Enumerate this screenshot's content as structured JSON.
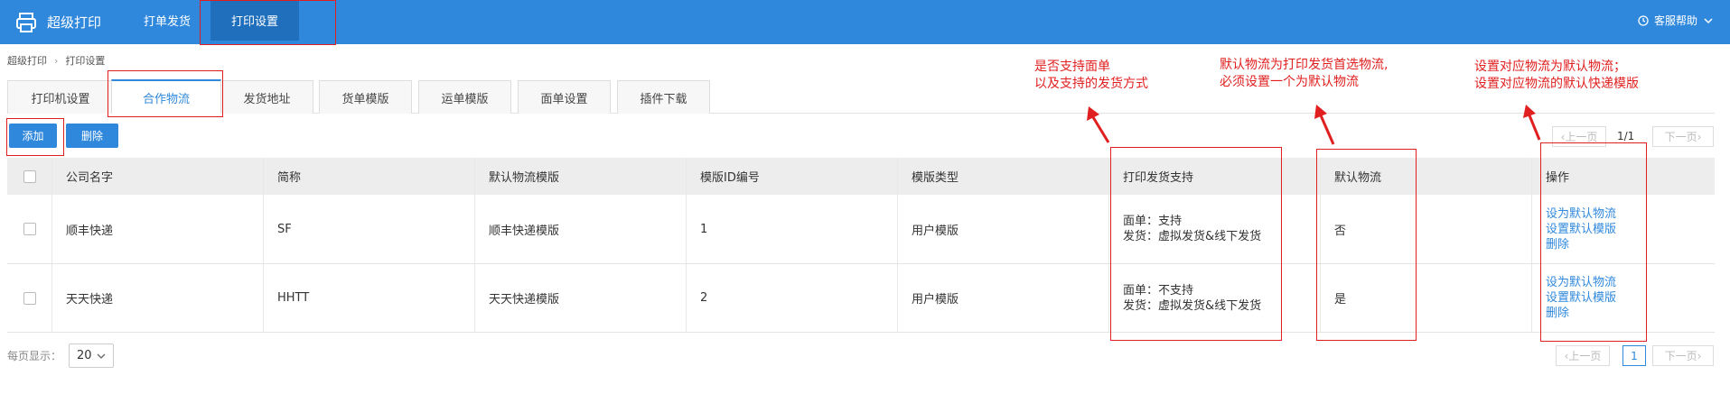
{
  "app": {
    "title": "超级打印"
  },
  "nav": [
    {
      "label": "打单发货"
    },
    {
      "label": "打印设置"
    }
  ],
  "help": {
    "label": "客服帮助"
  },
  "breadcrumb": {
    "root": "超级打印",
    "current": "打印设置"
  },
  "tabs": [
    {
      "label": "打印机设置"
    },
    {
      "label": "合作物流"
    },
    {
      "label": "发货地址"
    },
    {
      "label": "货单模版"
    },
    {
      "label": "运单模版"
    },
    {
      "label": "面单设置"
    },
    {
      "label": "插件下载"
    }
  ],
  "toolbar": {
    "add_label": "添加",
    "delete_label": "删除"
  },
  "pager_top": {
    "prev": "上一页",
    "page_info": "1/1",
    "next": "下一页"
  },
  "pager_bottom": {
    "prev": "上一页",
    "current": "1",
    "next": "下一页"
  },
  "table": {
    "headers": [
      "公司名字",
      "简称",
      "默认物流模版",
      "模版ID编号",
      "模版类型",
      "打印发货支持",
      "默认物流",
      "操作"
    ],
    "rows": [
      {
        "company": "顺丰快递",
        "short": "SF",
        "template": "顺丰快递模版",
        "template_id": "1",
        "template_type": "用户模版",
        "support_line1": "面单：支持",
        "support_line2": "发货：虚拟发货&线下发货",
        "is_default": "否",
        "actions": [
          "设为默认物流",
          "设置默认模版",
          "删除"
        ]
      },
      {
        "company": "天天快递",
        "short": "HHTT",
        "template": "天天快递模版",
        "template_id": "2",
        "template_type": "用户模版",
        "support_line1": "面单：不支持",
        "support_line2": "发货：虚拟发货&线下发货",
        "is_default": "是",
        "actions": [
          "设为默认物流",
          "设置默认模版",
          "删除"
        ]
      }
    ]
  },
  "per_page": {
    "label": "每页显示：",
    "value": "20"
  },
  "annotations": {
    "a1_line1": "是否支持面单",
    "a1_line2": "以及支持的发货方式",
    "a2_line1": "默认物流为打印发货首选物流,",
    "a2_line2": "必须设置一个为默认物流",
    "a3_line1": "设置对应物流为默认物流；",
    "a3_line2": "设置对应物流的默认快递模版"
  },
  "colors": {
    "primary": "#2f88dc",
    "annotation": "#e02020"
  }
}
